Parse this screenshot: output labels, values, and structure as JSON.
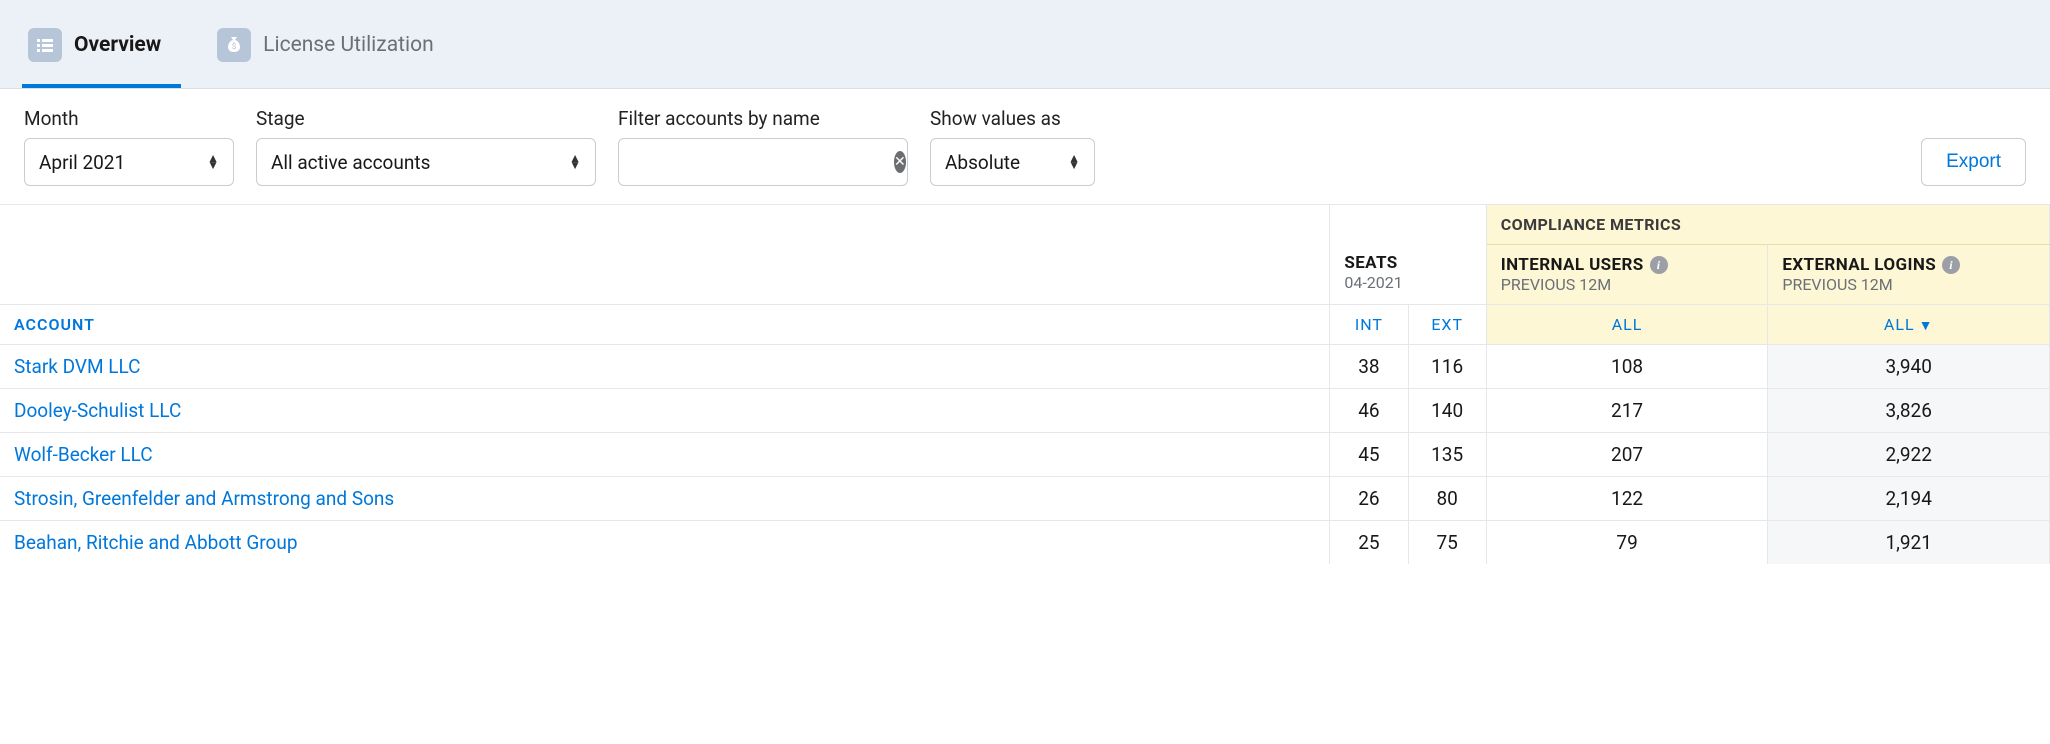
{
  "tabs": {
    "overview": "Overview",
    "license": "License Utilization"
  },
  "filters": {
    "month_label": "Month",
    "month_value": "April 2021",
    "stage_label": "Stage",
    "stage_value": "All active accounts",
    "filter_label": "Filter accounts by name",
    "filter_value": "",
    "show_label": "Show values as",
    "show_value": "Absolute"
  },
  "export_label": "Export",
  "headers": {
    "account": "ACCOUNT",
    "seats_title": "SEATS",
    "seats_date": "04-2021",
    "compliance_title": "COMPLIANCE METRICS",
    "internal_title": "INTERNAL USERS",
    "external_title": "EXTERNAL LOGINS",
    "previous_12m": "PREVIOUS 12M",
    "int": "INT",
    "ext": "EXT",
    "all": "ALL"
  },
  "rows": [
    {
      "account": "Stark DVM LLC",
      "int": "38",
      "ext": "116",
      "internal": "108",
      "external": "3,940"
    },
    {
      "account": "Dooley-Schulist LLC",
      "int": "46",
      "ext": "140",
      "internal": "217",
      "external": "3,826"
    },
    {
      "account": "Wolf-Becker LLC",
      "int": "45",
      "ext": "135",
      "internal": "207",
      "external": "2,922"
    },
    {
      "account": "Strosin, Greenfelder and Armstrong and Sons",
      "int": "26",
      "ext": "80",
      "internal": "122",
      "external": "2,194"
    },
    {
      "account": "Beahan, Ritchie and Abbott Group",
      "int": "25",
      "ext": "75",
      "internal": "79",
      "external": "1,921"
    }
  ]
}
